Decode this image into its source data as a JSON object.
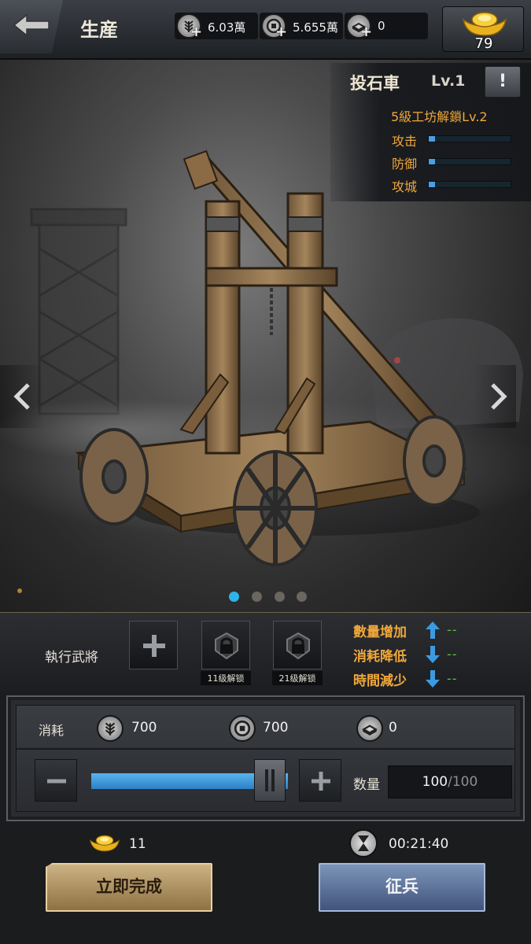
{
  "header": {
    "back_icon": "back-arrow-icon",
    "title": "生産",
    "resources": [
      {
        "icon": "grain-icon",
        "value": "6.03萬"
      },
      {
        "icon": "coin-icon",
        "value": "5.655萬"
      },
      {
        "icon": "stone-icon",
        "value": "0"
      }
    ],
    "gold": {
      "icon": "gold-ingot-icon",
      "count": "79"
    }
  },
  "unit": {
    "name": "投石車",
    "level": "Lv.1",
    "info_button": "!",
    "unlock_text": "5級工坊解鎖Lv.2",
    "stats": [
      {
        "label": "攻击",
        "fraction": 0.08
      },
      {
        "label": "防御",
        "fraction": 0.08
      },
      {
        "label": "攻城",
        "fraction": 0.08
      }
    ]
  },
  "carousel": {
    "pages": 4,
    "active_index": 0
  },
  "generals": {
    "label": "執行武將",
    "slots": [
      {
        "icon": "plus-icon",
        "caption": ""
      },
      {
        "icon": "lock-icon",
        "caption": "11级解锁"
      },
      {
        "icon": "lock-icon",
        "caption": "21级解锁"
      }
    ],
    "bonuses": [
      {
        "label": "數量增加",
        "direction": "up",
        "value": "--"
      },
      {
        "label": "消耗降低",
        "direction": "down",
        "value": "--"
      },
      {
        "label": "時間減少",
        "direction": "down",
        "value": "--"
      }
    ]
  },
  "cost": {
    "label": "消耗",
    "items": [
      {
        "icon": "grain-icon",
        "value": "700"
      },
      {
        "icon": "coin-icon",
        "value": "700"
      },
      {
        "icon": "stone-icon",
        "value": "0"
      }
    ]
  },
  "quantity": {
    "label": "数量",
    "current": "100",
    "separator": "/",
    "max": "100",
    "fraction": 1.0
  },
  "bottom": {
    "gold_cost": "11",
    "time": "00:21:40",
    "instant_button": "立即完成",
    "recruit_button": "征兵"
  },
  "colors": {
    "accent_orange": "#f0a83a",
    "accent_blue": "#2fb4e8",
    "bonus_green": "#5fbf4a"
  }
}
